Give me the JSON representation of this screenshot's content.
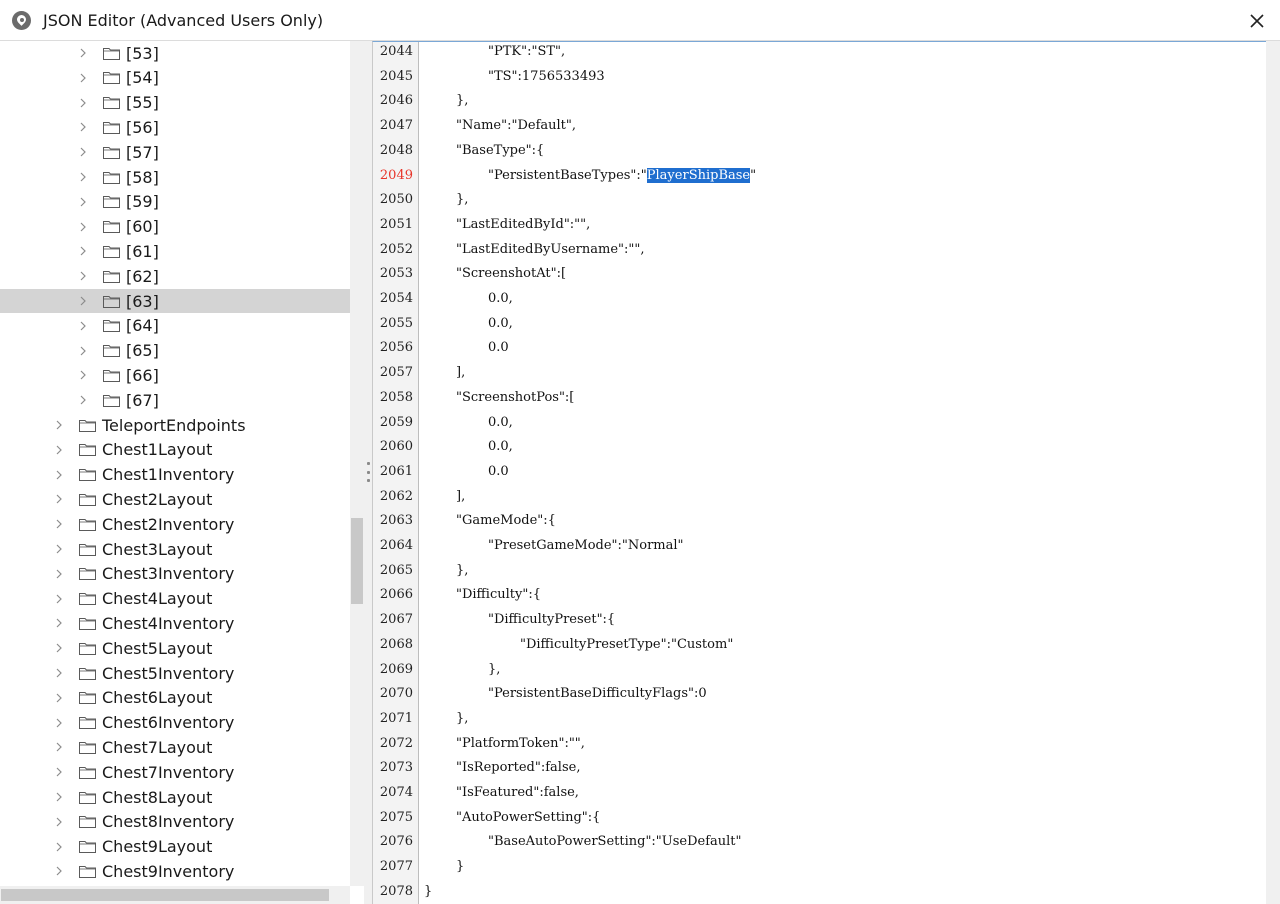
{
  "window": {
    "title": "JSON Editor (Advanced Users Only)",
    "app_icon": "map-pin-icon",
    "close_icon": "close-icon"
  },
  "tree": {
    "selected_label": "[63]",
    "items": [
      {
        "label": "[53]",
        "level": 2
      },
      {
        "label": "[54]",
        "level": 2
      },
      {
        "label": "[55]",
        "level": 2
      },
      {
        "label": "[56]",
        "level": 2
      },
      {
        "label": "[57]",
        "level": 2
      },
      {
        "label": "[58]",
        "level": 2
      },
      {
        "label": "[59]",
        "level": 2
      },
      {
        "label": "[60]",
        "level": 2
      },
      {
        "label": "[61]",
        "level": 2
      },
      {
        "label": "[62]",
        "level": 2
      },
      {
        "label": "[63]",
        "level": 2,
        "selected": true
      },
      {
        "label": "[64]",
        "level": 2
      },
      {
        "label": "[65]",
        "level": 2
      },
      {
        "label": "[66]",
        "level": 2
      },
      {
        "label": "[67]",
        "level": 2
      },
      {
        "label": "TeleportEndpoints",
        "level": 1
      },
      {
        "label": "Chest1Layout",
        "level": 1
      },
      {
        "label": "Chest1Inventory",
        "level": 1
      },
      {
        "label": "Chest2Layout",
        "level": 1
      },
      {
        "label": "Chest2Inventory",
        "level": 1
      },
      {
        "label": "Chest3Layout",
        "level": 1
      },
      {
        "label": "Chest3Inventory",
        "level": 1
      },
      {
        "label": "Chest4Layout",
        "level": 1
      },
      {
        "label": "Chest4Inventory",
        "level": 1
      },
      {
        "label": "Chest5Layout",
        "level": 1
      },
      {
        "label": "Chest5Inventory",
        "level": 1
      },
      {
        "label": "Chest6Layout",
        "level": 1
      },
      {
        "label": "Chest6Inventory",
        "level": 1
      },
      {
        "label": "Chest7Layout",
        "level": 1
      },
      {
        "label": "Chest7Inventory",
        "level": 1
      },
      {
        "label": "Chest8Layout",
        "level": 1
      },
      {
        "label": "Chest8Inventory",
        "level": 1
      },
      {
        "label": "Chest9Layout",
        "level": 1
      },
      {
        "label": "Chest9Inventory",
        "level": 1
      }
    ]
  },
  "editor": {
    "active_line": "2049",
    "selected_text": "PlayerShipBase",
    "lines": [
      {
        "no": "2044",
        "indent": 2,
        "text": "\"PTK\":\"ST\","
      },
      {
        "no": "2045",
        "indent": 2,
        "text": "\"TS\":1756533493"
      },
      {
        "no": "2046",
        "indent": 1,
        "text": "},"
      },
      {
        "no": "2047",
        "indent": 1,
        "text": "\"Name\":\"Default\","
      },
      {
        "no": "2048",
        "indent": 1,
        "text": "\"BaseType\":{"
      },
      {
        "no": "2049",
        "indent": 2,
        "text": "\"PersistentBaseTypes\":\"",
        "sel": "PlayerShipBase",
        "after": "\""
      },
      {
        "no": "2050",
        "indent": 1,
        "text": "},"
      },
      {
        "no": "2051",
        "indent": 1,
        "text": "\"LastEditedById\":\"\","
      },
      {
        "no": "2052",
        "indent": 1,
        "text": "\"LastEditedByUsername\":\"\","
      },
      {
        "no": "2053",
        "indent": 1,
        "text": "\"ScreenshotAt\":["
      },
      {
        "no": "2054",
        "indent": 2,
        "text": "0.0,"
      },
      {
        "no": "2055",
        "indent": 2,
        "text": "0.0,"
      },
      {
        "no": "2056",
        "indent": 2,
        "text": "0.0"
      },
      {
        "no": "2057",
        "indent": 1,
        "text": "],"
      },
      {
        "no": "2058",
        "indent": 1,
        "text": "\"ScreenshotPos\":["
      },
      {
        "no": "2059",
        "indent": 2,
        "text": "0.0,"
      },
      {
        "no": "2060",
        "indent": 2,
        "text": "0.0,"
      },
      {
        "no": "2061",
        "indent": 2,
        "text": "0.0"
      },
      {
        "no": "2062",
        "indent": 1,
        "text": "],"
      },
      {
        "no": "2063",
        "indent": 1,
        "text": "\"GameMode\":{"
      },
      {
        "no": "2064",
        "indent": 2,
        "text": "\"PresetGameMode\":\"Normal\""
      },
      {
        "no": "2065",
        "indent": 1,
        "text": "},"
      },
      {
        "no": "2066",
        "indent": 1,
        "text": "\"Difficulty\":{"
      },
      {
        "no": "2067",
        "indent": 2,
        "text": "\"DifficultyPreset\":{"
      },
      {
        "no": "2068",
        "indent": 3,
        "text": "\"DifficultyPresetType\":\"Custom\""
      },
      {
        "no": "2069",
        "indent": 2,
        "text": "},"
      },
      {
        "no": "2070",
        "indent": 2,
        "text": "\"PersistentBaseDifficultyFlags\":0"
      },
      {
        "no": "2071",
        "indent": 1,
        "text": "},"
      },
      {
        "no": "2072",
        "indent": 1,
        "text": "\"PlatformToken\":\"\","
      },
      {
        "no": "2073",
        "indent": 1,
        "text": "\"IsReported\":false,"
      },
      {
        "no": "2074",
        "indent": 1,
        "text": "\"IsFeatured\":false,"
      },
      {
        "no": "2075",
        "indent": 1,
        "text": "\"AutoPowerSetting\":{"
      },
      {
        "no": "2076",
        "indent": 2,
        "text": "\"BaseAutoPowerSetting\":\"UseDefault\""
      },
      {
        "no": "2077",
        "indent": 1,
        "text": "}"
      },
      {
        "no": "2078",
        "indent": 0,
        "text": "}"
      }
    ]
  },
  "colors": {
    "selection": "#1f6ecf",
    "active_line_number": "#e8352a",
    "tree_selected_row": "#d4d4d4"
  }
}
